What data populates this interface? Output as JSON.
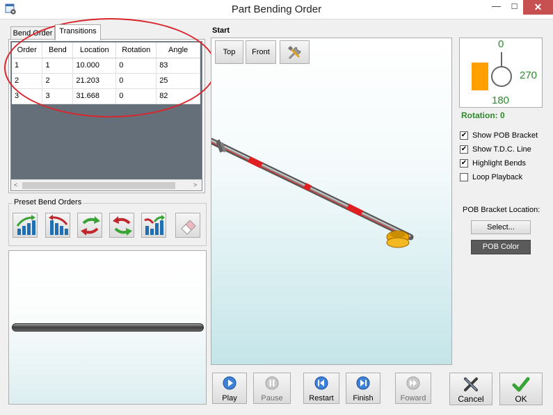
{
  "window": {
    "title": "Part Bending Order",
    "minimize_glyph": "—",
    "maximize_glyph": "☐",
    "close_glyph": "✕",
    "app_icon": "settings-window-icon"
  },
  "tabs": [
    {
      "label": "Bend Order",
      "selected": false
    },
    {
      "label": "Transitions",
      "selected": true
    }
  ],
  "grid": {
    "columns": [
      "Order",
      "Bend",
      "Location",
      "Rotation",
      "Angle"
    ],
    "rows": [
      [
        "1",
        "1",
        "10.000",
        "0",
        "83"
      ],
      [
        "2",
        "2",
        "21.203",
        "0",
        "25"
      ],
      [
        "3",
        "3",
        "31.668",
        "0",
        "82"
      ]
    ],
    "scroll_left": "<",
    "scroll_right": ">"
  },
  "annotation": {
    "color": "#d9262c"
  },
  "preset": {
    "label": "Preset Bend Orders",
    "buttons": [
      "ascending-bars-icon",
      "descending-bars-icon",
      "swap-green-red-icon",
      "swap-red-green-icon",
      "mixed-bars-icon",
      "eraser-icon"
    ]
  },
  "viewport": {
    "label": "Start",
    "buttons": {
      "top": "Top",
      "front": "Front",
      "tools": "tools-icon"
    }
  },
  "indicator": {
    "top": "0",
    "right": "270",
    "bottom": "180",
    "rotation_label": "Rotation: 0",
    "accent": "#ffa000",
    "text_color": "#2d8a2d"
  },
  "options": [
    {
      "label": "Show POB Bracket",
      "checked": true
    },
    {
      "label": "Show T.D.C. Line",
      "checked": true
    },
    {
      "label": "Highlight Bends",
      "checked": true
    },
    {
      "label": "Loop Playback",
      "checked": false
    }
  ],
  "pob": {
    "location_label": "POB Bracket Location:",
    "select_label": "Select...",
    "color_label": "POB Color"
  },
  "playback": [
    {
      "label": "Play",
      "icon": "play-icon",
      "enabled": true
    },
    {
      "label": "Pause",
      "icon": "pause-icon",
      "enabled": false
    },
    {
      "label": "Restart",
      "icon": "restart-icon",
      "enabled": true
    },
    {
      "label": "Finish",
      "icon": "finish-icon",
      "enabled": true
    },
    {
      "label": "Foward",
      "icon": "forward-icon",
      "enabled": false
    }
  ],
  "dialog": {
    "cancel": "Cancel",
    "ok": "OK"
  }
}
